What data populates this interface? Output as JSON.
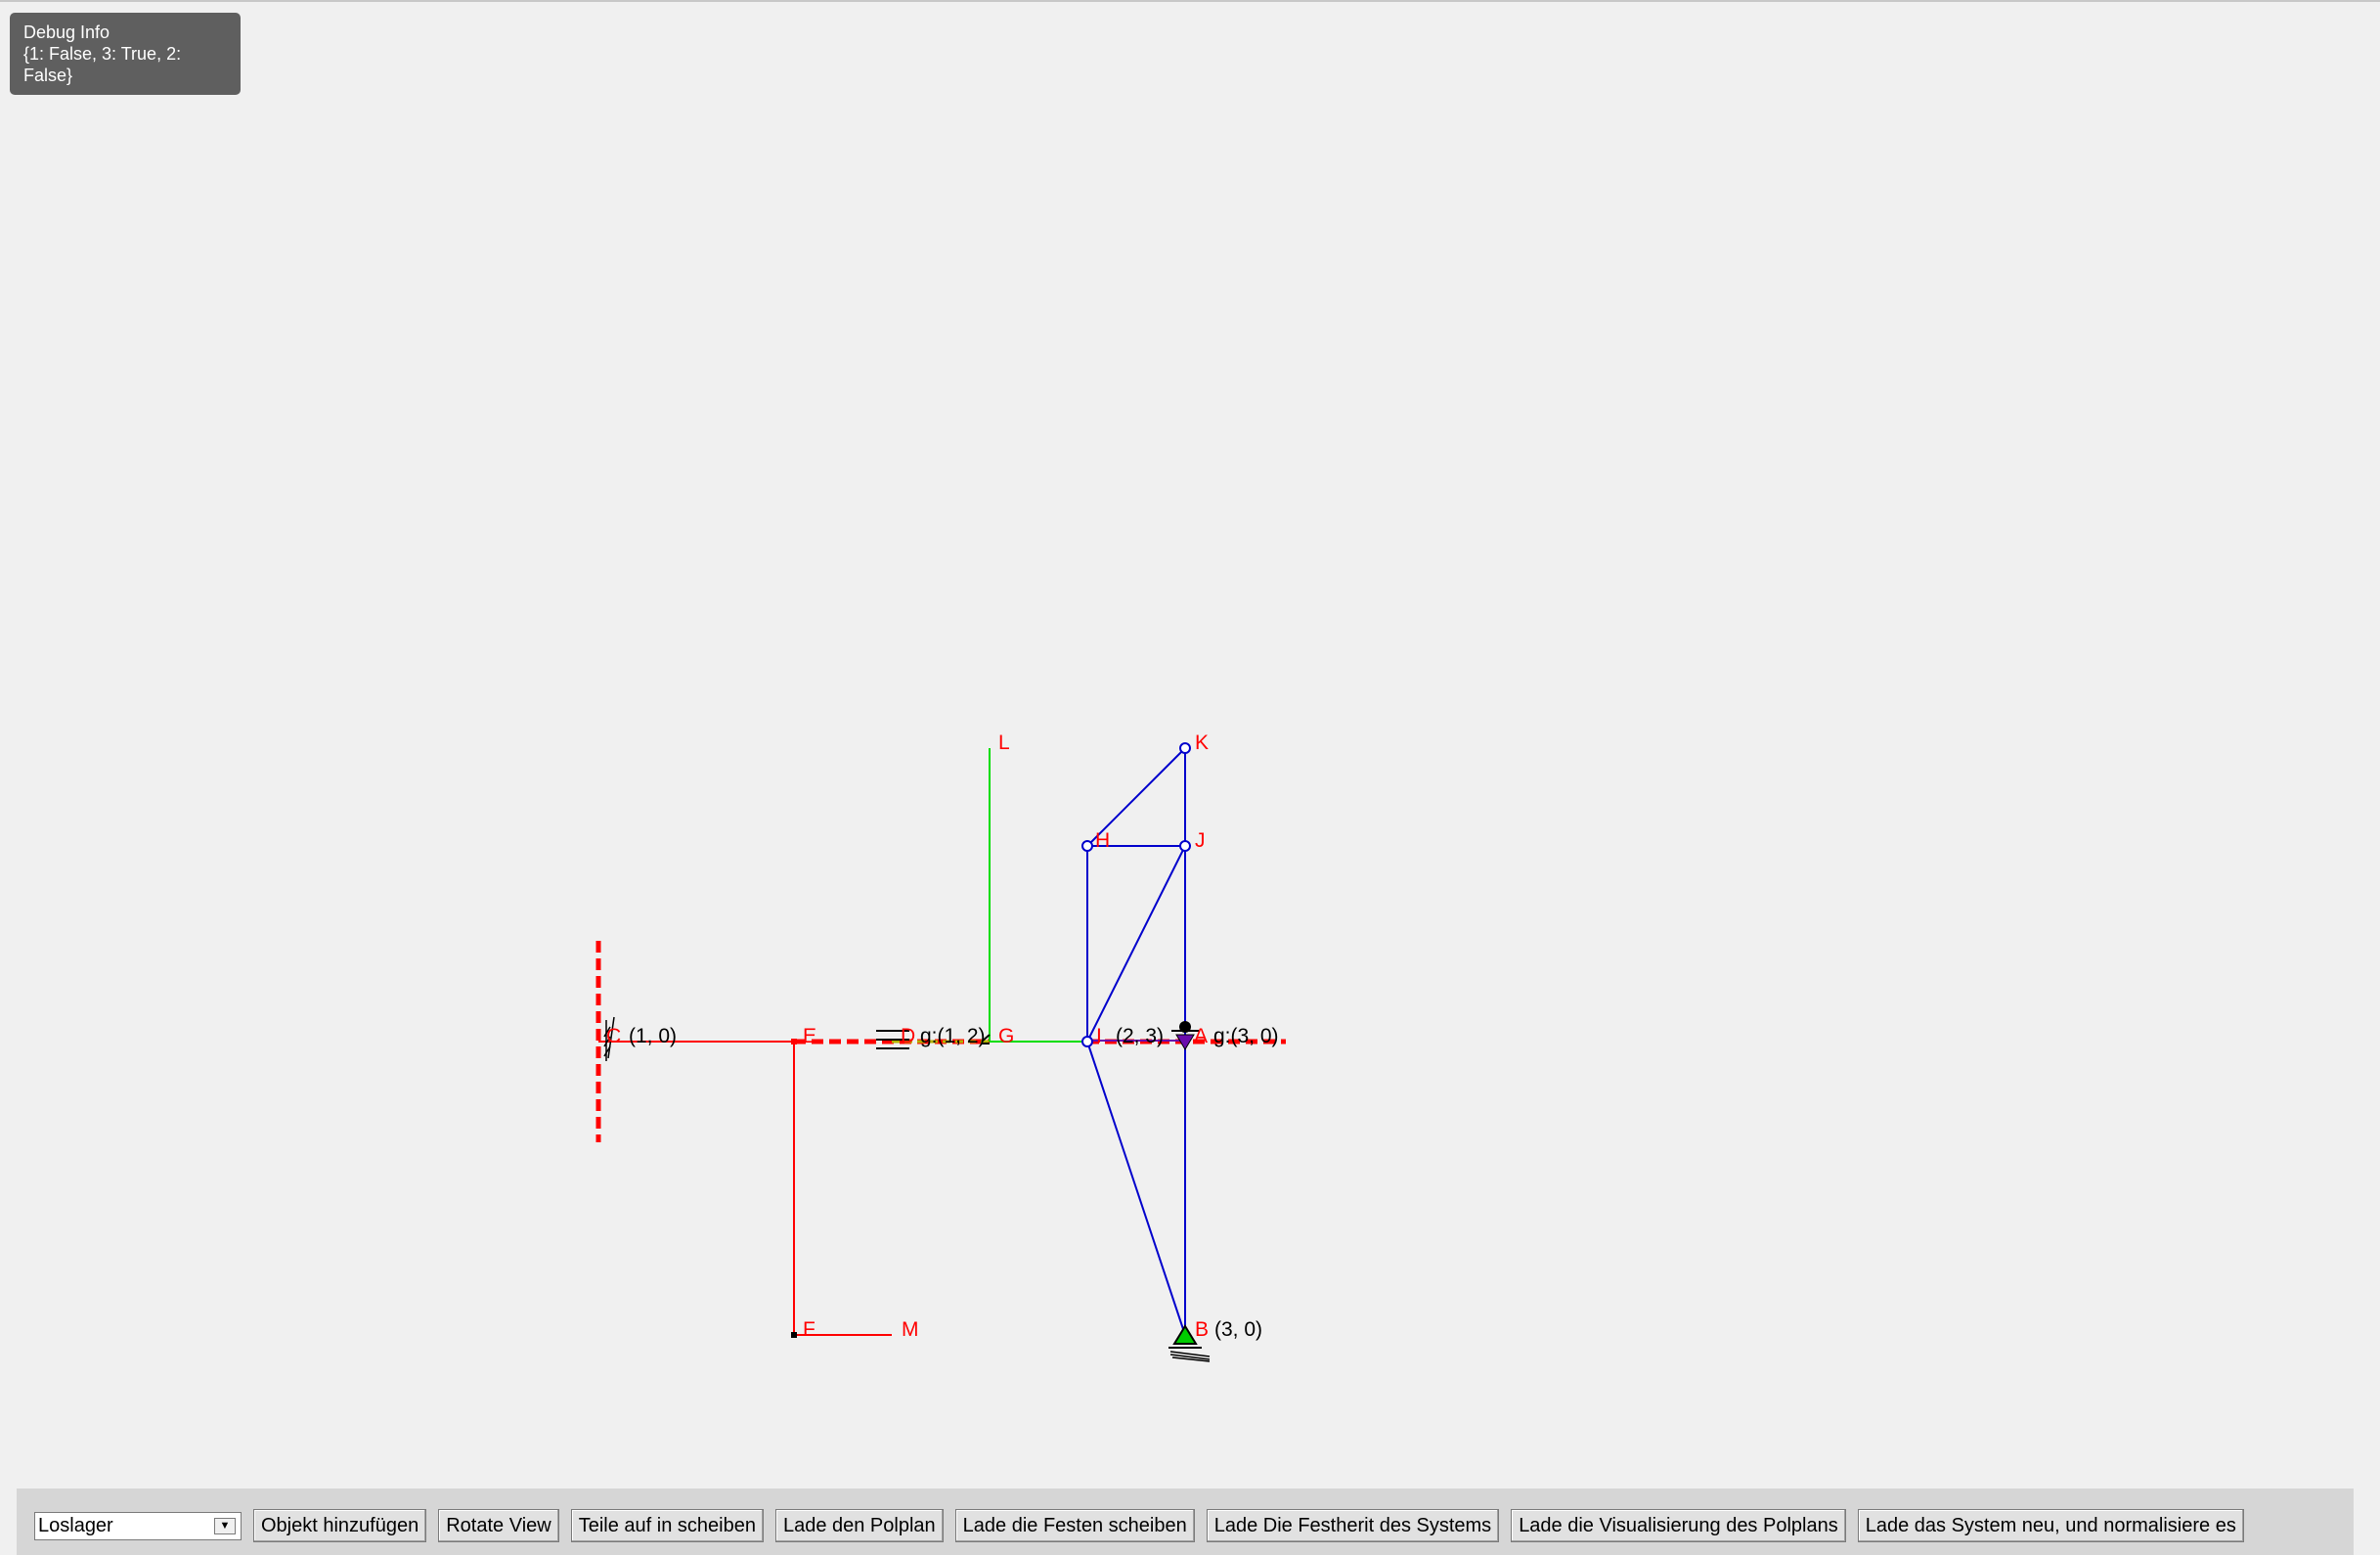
{
  "debug": {
    "title": "Debug Info",
    "line1": "{1: False, 3: True, 2:",
    "line2": "False}"
  },
  "diagram": {
    "labels": {
      "L_top": "L",
      "K": "K",
      "H": "H",
      "J": "J",
      "C": "C",
      "C_coord": "(1, 0)",
      "E": "E",
      "D": "D",
      "D_coord": "g:(1, 2)",
      "G": "G",
      "I": "I",
      "I_coord": "(2, 3)",
      "A": "A",
      "A_coord": "g:(3, 0)",
      "F": "F",
      "M": "M",
      "B": "B",
      "B_coord": "(3, 0)"
    },
    "colors": {
      "red": "#ff0000",
      "green": "#00dd00",
      "blue": "#0000cc",
      "purple": "#6a0dad",
      "support_fill": "#00cc00"
    }
  },
  "toolbar": {
    "dropdown_value": "Loslager",
    "buttons": [
      "Objekt hinzufügen",
      "Rotate View",
      "Teile auf in scheiben",
      "Lade den Polplan",
      "Lade die Festen scheiben",
      "Lade Die Festherit des Systems",
      "Lade die Visualisierung des Polplans",
      "Lade das System neu, und normalisiere es"
    ]
  }
}
